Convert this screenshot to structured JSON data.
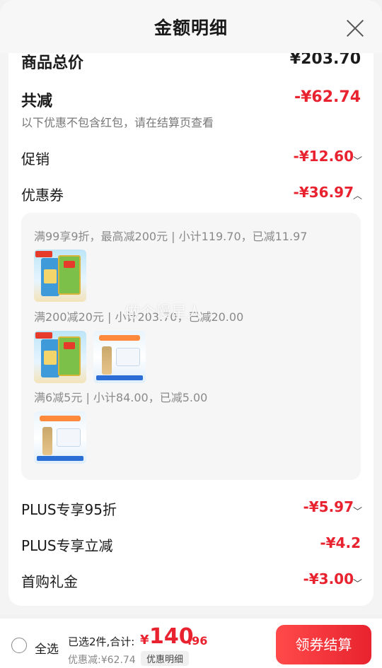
{
  "header": {
    "title": "金额明细"
  },
  "summary": {
    "goods_total_label": "商品总价",
    "goods_total_value": "¥203.70",
    "total_discount_label": "共减",
    "total_discount_value": "-¥62.74",
    "note": "以下优惠不包含红包，请在结算页查看"
  },
  "items": {
    "promo_label": "促销",
    "promo_value": "-¥12.60",
    "coupon_label": "优惠券",
    "coupon_value": "-¥36.97",
    "plus95_label": "PLUS专享95折",
    "plus95_value": "-¥5.97",
    "plusinstant_label": "PLUS专享立减",
    "plusinstant_value": "-¥4.2",
    "firstbuy_label": "首购礼金",
    "firstbuy_value": "-¥3.00"
  },
  "coupons": [
    {
      "text": "满99享9折，最高减200元 | 小计119.70，已减11.97"
    },
    {
      "text": "满200减20元 | 小计203.70，已减20.00"
    },
    {
      "text": "满6减5元 | 小计84.00，已减5.00"
    }
  ],
  "watermark": "做个慢星人",
  "footer": {
    "select_all": "全选",
    "summary_label": "已选2件,合计:",
    "currency": "¥",
    "price_int": "140",
    "price_dec": ".96",
    "discount": "优惠减:¥62.74",
    "detail_button": "优惠明细",
    "checkout_button": "领券结算"
  },
  "icons": {
    "close": "close-icon",
    "chevron_down": "chevron-down-icon",
    "chevron_up": "chevron-up-icon"
  }
}
